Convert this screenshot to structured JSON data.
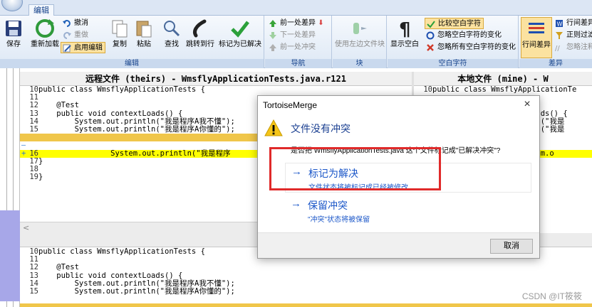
{
  "ribbon": {
    "tab_label": "编辑",
    "groups": {
      "edit": "编辑",
      "navigate": "导航",
      "block": "块",
      "whitespace": "空白字符",
      "diff": "差异"
    },
    "buttons": {
      "save": "保存",
      "reload": "重新加载",
      "undo": "撤消",
      "redo": "重做",
      "enable_edit": "启用编辑",
      "copy": "复制",
      "paste": "粘贴",
      "find": "查找",
      "goto_line": "跳转到行",
      "mark_resolved": "标记为已解决",
      "prev_diff": "前一处差异",
      "next_diff": "下一处差异",
      "prev_conflict": "前一处冲突",
      "use_left_block": "使用左边文件块",
      "show_whitespace": "显示空白",
      "compare_whitespace": "比较空白字符",
      "ignore_ws_changes": "忽略空白字符的变化",
      "ignore_all_ws_changes": "忽略所有空白字符的变化",
      "inline_diff": "行间差异",
      "line_diff": "行间差异",
      "regex_filter": "正则过滤",
      "ignore_comments": "忽略注释"
    }
  },
  "left_pane": {
    "header": "远程文件 (theirs) - WmsflyApplicationTests.java.r121",
    "lines": [
      {
        "n": "10",
        "text": "public class WmsflyApplicationTests {",
        "hl": ""
      },
      {
        "n": "11",
        "text": "",
        "hl": ""
      },
      {
        "n": "12",
        "text": "    @Test",
        "hl": ""
      },
      {
        "n": "13",
        "text": "    public void contextLoads() {",
        "hl": ""
      },
      {
        "n": "14",
        "text": "        System.out.println(\"我是程序A我不懂\");",
        "hl": ""
      },
      {
        "n": "15",
        "text": "        System.out.println(\"我是程序A你懂的\");",
        "hl": ""
      },
      {
        "n": "",
        "text": "",
        "hl": "gold"
      },
      {
        "n": "",
        "text": "",
        "hl": ""
      },
      {
        "n": "16",
        "text": "                System.out.println(\"我是程序",
        "hl": "yellow"
      },
      {
        "n": "17",
        "text": "}",
        "hl": ""
      },
      {
        "n": "18",
        "text": "",
        "hl": ""
      },
      {
        "n": "19",
        "text": "}",
        "hl": ""
      }
    ],
    "gutter_dash": "–",
    "gutter_plus": "+"
  },
  "right_pane": {
    "header": "本地文件 (mine) - W",
    "lines": [
      {
        "n": "10",
        "text": "public class WmsflyApplicationTe",
        "hl": ""
      },
      {
        "n": "",
        "text": "",
        "hl": ""
      },
      {
        "n": "",
        "text": "",
        "hl": ""
      },
      {
        "n": "",
        "text": "                   xtLoads() {",
        "hl": ""
      },
      {
        "n": "",
        "text": "                   intln(\"我是",
        "hl": ""
      },
      {
        "n": "",
        "text": "                   intln(\"我是",
        "hl": ""
      },
      {
        "n": "",
        "text": "",
        "hl": ""
      },
      {
        "n": "",
        "text": "",
        "hl": ""
      },
      {
        "n": "",
        "text": "                   System.o",
        "hl": "yellow"
      }
    ]
  },
  "bottom_pane": {
    "lines": [
      {
        "n": "10",
        "text": "public class WmsflyApplicationTests {"
      },
      {
        "n": "11",
        "text": ""
      },
      {
        "n": "12",
        "text": "    @Test"
      },
      {
        "n": "13",
        "text": "    public void contextLoads() {"
      },
      {
        "n": "14",
        "text": "        System.out.println(\"我是程序A我不懂\");"
      },
      {
        "n": "15",
        "text": "        System.out.println(\"我是程序A你懂的\");"
      }
    ]
  },
  "scroll_left_arrow": "<",
  "dialog": {
    "title": "TortoiseMerge",
    "close": "×",
    "heading": "文件没有冲突",
    "question": "是否把 WmsflyApplicationTests.java 这个文件标记成\"已解决冲突\"?",
    "option_resolve": {
      "arrow": "→",
      "title": "标记为解决",
      "subtitle": "文件状态将被标记成已经被修改"
    },
    "option_keep": {
      "arrow": "→",
      "title": "保留冲突",
      "subtitle": "\"冲突\"状态将被保留"
    },
    "cancel": "取消"
  },
  "watermark": "CSDN @IT筱筱",
  "colors": {
    "conflict_yellow": "#ffff00",
    "conflict_gold": "#f0c64a",
    "link_blue": "#1a56c8",
    "highlight_red": "#e02a2a"
  }
}
